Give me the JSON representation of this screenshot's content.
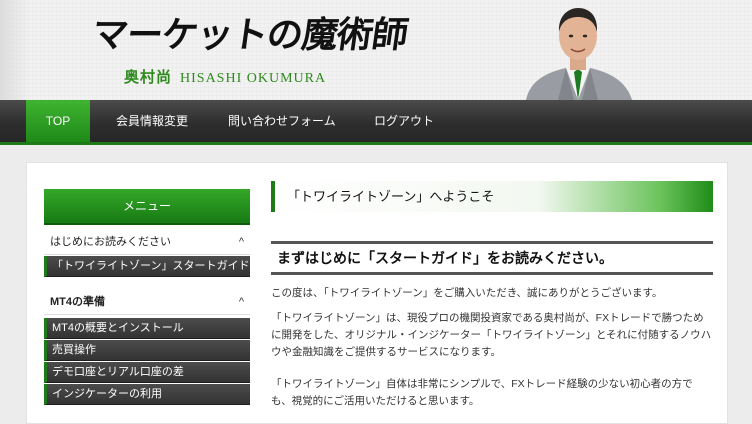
{
  "header": {
    "logo_title": "マーケットの魔術師",
    "logo_name_jp": "奥村尚",
    "logo_name_en": "HISASHI OKUMURA"
  },
  "nav": {
    "items": [
      {
        "label": "TOP",
        "active": true
      },
      {
        "label": "会員情報変更"
      },
      {
        "label": "問い合わせフォーム"
      },
      {
        "label": "ログアウト"
      }
    ]
  },
  "sidebar": {
    "menu_title": "メニュー",
    "groups": [
      {
        "label": "はじめにお読みください",
        "caret": "^",
        "items": [
          "「トワイライトゾーン」スタートガイド"
        ]
      },
      {
        "label": "MT4の準備",
        "caret": "^",
        "items": [
          "MT4の概要とインストール",
          "売買操作",
          "デモ口座とリアル口座の差",
          "インジケーターの利用"
        ]
      }
    ]
  },
  "main": {
    "welcome": "「トワイライトゾーン」へようこそ",
    "guide_heading": "まずはじめに「スタートガイド」をお読みください。",
    "paragraphs": [
      "この度は、「トワイライトゾーン」をご購入いただき、誠にありがとうございます。",
      "「トワイライトゾーン」は、現役プロの機関投資家である奥村尚が、FXトレードで勝つために開発をした、オリジナル・インジケーター「トワイライトゾーン」とそれに付随するノウハウや金融知識をご提供するサービスになります。",
      "「トワイライトゾーン」自体は非常にシンプルで、FXトレード経験の少ない初心者の方でも、視覚的にご活用いただけると思います。"
    ]
  },
  "colors": {
    "accent_green": "#1f7a1a",
    "nav_dark": "#2e2e2e"
  }
}
